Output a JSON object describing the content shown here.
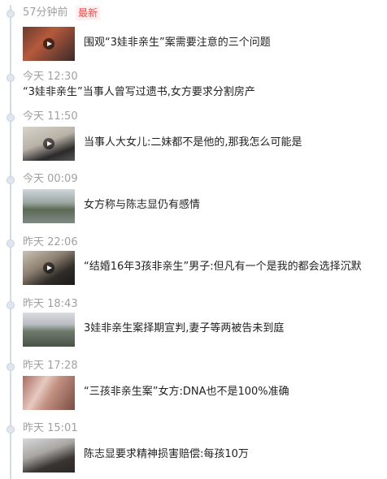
{
  "feed": {
    "items": [
      {
        "time": "57分钟前",
        "badge": "最新",
        "headline": "围观“3娃非亲生”案需要注意的三个问题",
        "has_thumb": true,
        "thumb_icon": "play-icon"
      },
      {
        "time": "今天 12:30",
        "headline": "“3娃非亲生”当事人曾写过遗书,女方要求分割房产",
        "has_thumb": false
      },
      {
        "time": "今天 11:50",
        "headline": "当事人大女儿:二妹都不是他的,那我怎么可能是",
        "has_thumb": true,
        "thumb_icon": "play-icon"
      },
      {
        "time": "今天 00:09",
        "headline": "女方称与陈志显仍有感情",
        "has_thumb": true
      },
      {
        "time": "昨天 22:06",
        "headline": "“结婚16年3孩非亲生”男子:但凡有一个是我的都会选择沉默",
        "has_thumb": true,
        "thumb_icon": "play-icon"
      },
      {
        "time": "昨天 18:43",
        "headline": "3娃非亲生案择期宣判,妻子等两被告未到庭",
        "has_thumb": true
      },
      {
        "time": "昨天 17:28",
        "headline": "“三孩非亲生案”女方:DNA也不是100%准确",
        "has_thumb": true
      },
      {
        "time": "昨天 15:01",
        "headline": "陈志显要求精神损害赔偿:每孩10万",
        "has_thumb": true
      }
    ]
  },
  "colors": {
    "time_text": "#a0a0a0",
    "headline_text": "#222222",
    "badge_text": "#f34b4b",
    "timeline": "#d3dbe7"
  }
}
